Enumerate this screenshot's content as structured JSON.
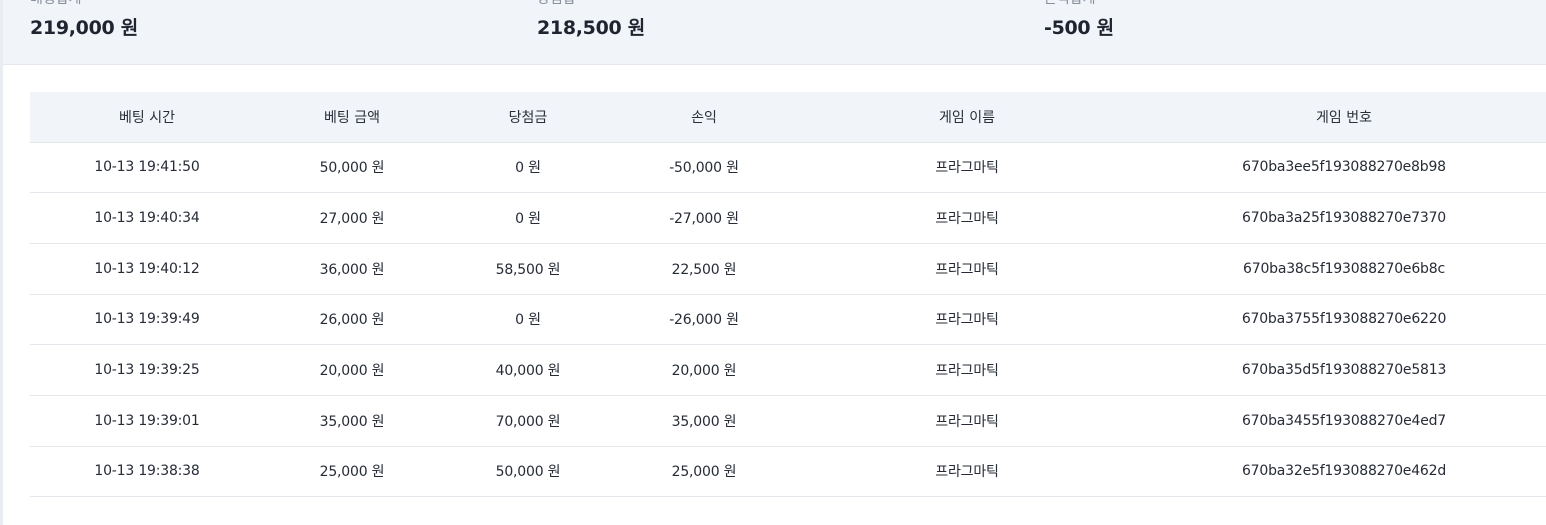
{
  "summary": {
    "bet_total": {
      "label": "배팅합계",
      "value": "219,000 원"
    },
    "win_total": {
      "label": "당첨합",
      "value": "218,500 원"
    },
    "profit_total": {
      "label": "손익합계",
      "value": "-500 원"
    }
  },
  "table": {
    "headers": [
      "베팅 시간",
      "베팅 금액",
      "당첨금",
      "손익",
      "게임 이름",
      "게임 번호"
    ],
    "rows": [
      [
        "10-13 19:41:50",
        "50,000 원",
        "0 원",
        "-50,000 원",
        "프라그마틱",
        "670ba3ee5f193088270e8b98"
      ],
      [
        "10-13 19:40:34",
        "27,000 원",
        "0 원",
        "-27,000 원",
        "프라그마틱",
        "670ba3a25f193088270e7370"
      ],
      [
        "10-13 19:40:12",
        "36,000 원",
        "58,500 원",
        "22,500 원",
        "프라그마틱",
        "670ba38c5f193088270e6b8c"
      ],
      [
        "10-13 19:39:49",
        "26,000 원",
        "0 원",
        "-26,000 원",
        "프라그마틱",
        "670ba3755f193088270e6220"
      ],
      [
        "10-13 19:39:25",
        "20,000 원",
        "40,000 원",
        "20,000 원",
        "프라그마틱",
        "670ba35d5f193088270e5813"
      ],
      [
        "10-13 19:39:01",
        "35,000 원",
        "70,000 원",
        "35,000 원",
        "프라그마틱",
        "670ba3455f193088270e4ed7"
      ],
      [
        "10-13 19:38:38",
        "25,000 원",
        "50,000 원",
        "25,000 원",
        "프라그마틱",
        "670ba32e5f193088270e462d"
      ]
    ]
  }
}
